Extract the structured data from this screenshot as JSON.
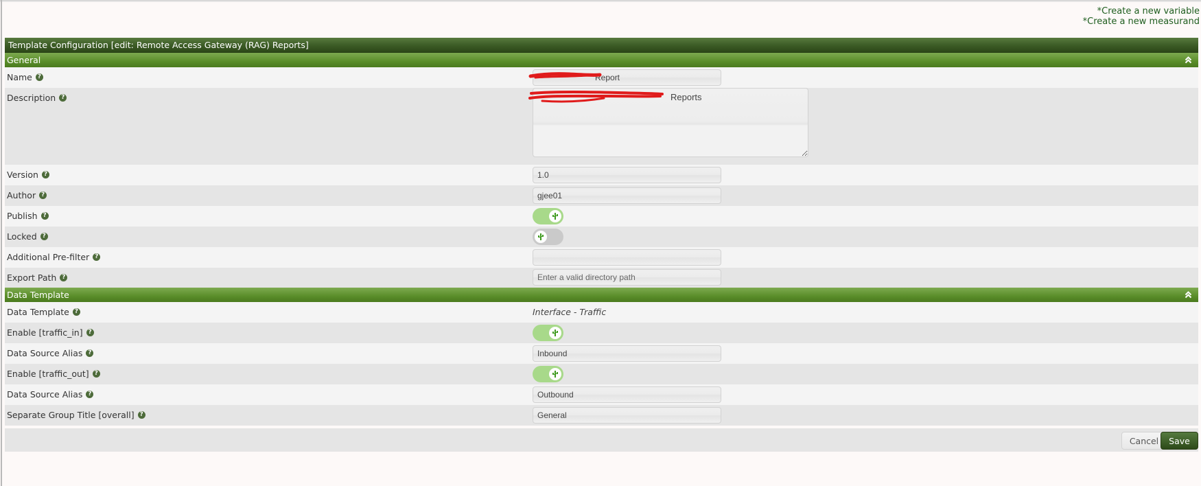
{
  "links": {
    "create_variable": "*Create a new variable",
    "create_measurand": "*Create a new measurand"
  },
  "panel": {
    "title": "Template Configuration [edit: Remote Access Gateway (RAG) Reports]"
  },
  "sections": {
    "general": {
      "title": "General",
      "collapse_icon": "double-chevron-up-icon",
      "fields": {
        "name": {
          "label": "Name",
          "value": "Report",
          "redacted": true
        },
        "description": {
          "label": "Description",
          "value": "Reports",
          "redacted": true
        },
        "version": {
          "label": "Version",
          "value": "1.0"
        },
        "author": {
          "label": "Author",
          "value": "gjee01"
        },
        "publish": {
          "label": "Publish",
          "state": "on"
        },
        "locked": {
          "label": "Locked",
          "state": "off"
        },
        "prefilter": {
          "label": "Additional Pre-filter",
          "value": ""
        },
        "export_path": {
          "label": "Export Path",
          "value": "",
          "placeholder": "Enter a valid directory path"
        }
      }
    },
    "data_template": {
      "title": "Data Template",
      "collapse_icon": "double-chevron-up-icon",
      "fields": {
        "data_template": {
          "label": "Data Template",
          "value": "Interface - Traffic"
        },
        "enable_in": {
          "label": "Enable [traffic_in]",
          "state": "on"
        },
        "alias_in": {
          "label": "Data Source Alias",
          "value": "Inbound"
        },
        "enable_out": {
          "label": "Enable [traffic_out]",
          "state": "on"
        },
        "alias_out": {
          "label": "Data Source Alias",
          "value": "Outbound"
        },
        "group_title": {
          "label": "Separate Group Title [overall]",
          "value": "General"
        }
      }
    }
  },
  "footer": {
    "cancel_label": "Cancel",
    "save_label": "Save"
  },
  "help_icon_glyph": "?",
  "colors": {
    "header_dark_green": "#3c5c26",
    "section_green": "#5a8d2a",
    "link_green": "#1f5e1f",
    "toggle_on": "#a8d98a",
    "toggle_off": "#cacaca",
    "redaction_red": "#e01b1b"
  }
}
